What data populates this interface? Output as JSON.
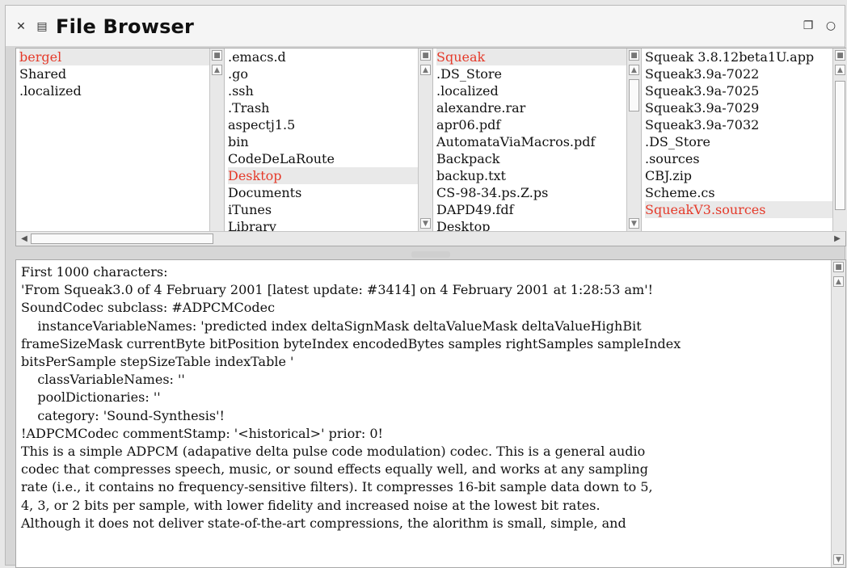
{
  "window": {
    "title": "File Browser",
    "close_icon": "close-icon",
    "menu_icon": "menu-icon",
    "collapse_icon": "collapse-icon",
    "expand_icon": "expand-icon"
  },
  "lists": [
    {
      "items": [
        "bergel",
        "Shared",
        ".localized"
      ],
      "selected": 0
    },
    {
      "items": [
        ".emacs.d",
        ".go",
        ".ssh",
        ".Trash",
        "aspectj1.5",
        "bin",
        "CodeDeLaRoute",
        "Desktop",
        "Documents",
        "iTunes",
        "Library"
      ],
      "selected": 7
    },
    {
      "items": [
        "Squeak",
        ".DS_Store",
        ".localized",
        "alexandre.rar",
        "apr06.pdf",
        "AutomataViaMacros.pdf",
        "Backpack",
        "backup.txt",
        "CS-98-34.ps.Z.ps",
        "DAPD49.fdf",
        "Desktop"
      ],
      "selected": 0
    },
    {
      "items": [
        "Squeak 3.8.12beta1U.app",
        "Squeak3.9a-7022",
        "Squeak3.9a-7025",
        "Squeak3.9a-7029",
        "Squeak3.9a-7032",
        ".DS_Store",
        ".sources",
        "CBJ.zip",
        "Scheme.cs",
        "SqueakV3.sources"
      ],
      "selected": 9
    }
  ],
  "content": {
    "lines": [
      "First 1000 characters:",
      "'From Squeak3.0 of 4 February 2001 [latest update: #3414] on 4 February 2001 at 1:28:53 am'!",
      "SoundCodec subclass: #ADPCMCodec",
      "    instanceVariableNames: 'predicted index deltaSignMask deltaValueMask deltaValueHighBit",
      "frameSizeMask currentByte bitPosition byteIndex encodedBytes samples rightSamples sampleIndex",
      "bitsPerSample stepSizeTable indexTable '",
      "    classVariableNames: ''",
      "    poolDictionaries: ''",
      "    category: 'Sound-Synthesis'!",
      "!ADPCMCodec commentStamp: '<historical>' prior: 0!",
      "This is a simple ADPCM (adapative delta pulse code modulation) codec. This is a general audio",
      "codec that compresses speech, music, or sound effects equally well, and works at any sampling",
      "rate (i.e., it contains no frequency-sensitive filters). It compresses 16-bit sample data down to 5,",
      "4, 3, or 2 bits per sample, with lower fidelity and increased noise at the lowest bit rates.",
      "Although it does not deliver state-of-the-art compressions, the alorithm is small, simple, and"
    ]
  }
}
